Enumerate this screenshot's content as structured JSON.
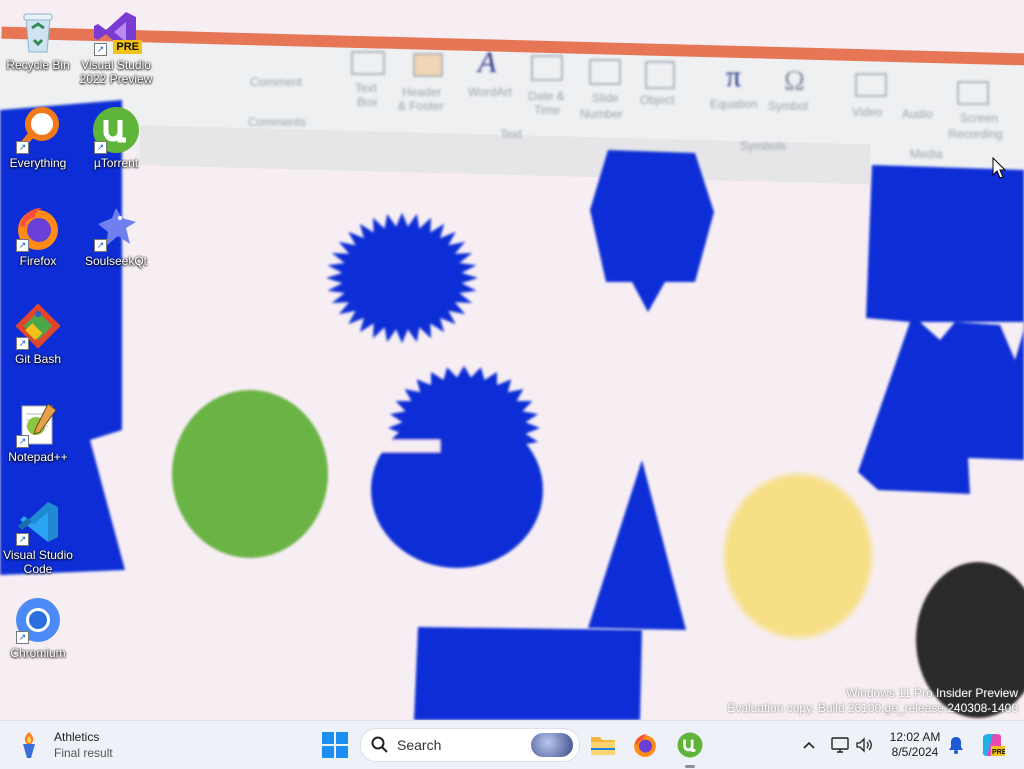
{
  "desktop": {
    "icons": [
      {
        "label": "Recycle Bin",
        "icon": "recycle-bin-icon",
        "shortcut": false
      },
      {
        "label": "Visual Studio\n2022 Preview",
        "icon": "visual-studio-icon",
        "badge": "PRE",
        "shortcut": true
      },
      {
        "label": "Everything",
        "icon": "everything-search-icon",
        "shortcut": true
      },
      {
        "label": "µTorrent",
        "icon": "utorrent-icon",
        "shortcut": true
      },
      {
        "label": "Firefox",
        "icon": "firefox-icon",
        "shortcut": true
      },
      {
        "label": "SoulseekQt",
        "icon": "soulseek-icon",
        "shortcut": true
      },
      {
        "label": "Git Bash",
        "icon": "git-bash-icon",
        "shortcut": true
      },
      {
        "label": "Notepad++",
        "icon": "notepad-plus-plus-icon",
        "shortcut": true
      },
      {
        "label": "Visual Studio\nCode",
        "icon": "vscode-icon",
        "shortcut": true
      },
      {
        "label": "Chromium",
        "icon": "chromium-icon",
        "shortcut": true
      }
    ],
    "wallpaper": {
      "description_icons": [
        "ribbon-toolbar",
        "starburst-shape",
        "hexagon-shape",
        "oval-shape",
        "triangle-shape",
        "rectangle-shape"
      ],
      "ribbon_labels": [
        "Comment",
        "Comments",
        "Text\nBox",
        "Header\n& Footer",
        "WordArt",
        "Date &\nTime",
        "Slide\nNumber",
        "Object",
        "Text",
        "Equation",
        "Symbol",
        "Symbols",
        "Video",
        "Audio",
        "Screen\nRecording",
        "Media"
      ],
      "colors": {
        "blue": "#0a2fd6",
        "green": "#6ab344",
        "yellow": "#f7df86",
        "dark": "#2c2c2c",
        "background": "#f7eef4"
      }
    },
    "watermark": {
      "line1": "Windows 11 Pro Insider Preview",
      "line2": "Evaluation copy. Build 26100.ge_release.240308-1400"
    }
  },
  "taskbar": {
    "widget": {
      "title": "Athletics",
      "subtitle": "Final result",
      "icon": "torch-icon"
    },
    "search": {
      "label": "Search"
    },
    "pinned": [
      {
        "name": "start",
        "icon": "windows-start-icon"
      },
      {
        "name": "file-explorer",
        "icon": "folder-icon"
      },
      {
        "name": "firefox",
        "icon": "firefox-icon"
      },
      {
        "name": "utorrent",
        "icon": "utorrent-icon",
        "active": true
      }
    ],
    "tray": {
      "chevron": "^",
      "time": "12:02 AM",
      "date": "8/5/2024"
    }
  }
}
